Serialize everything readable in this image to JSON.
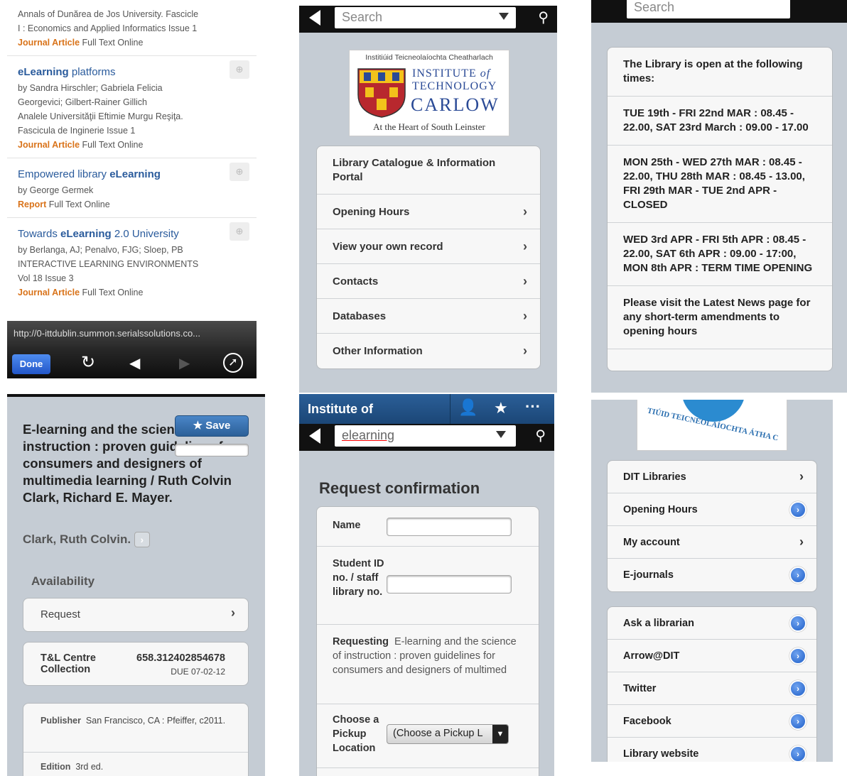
{
  "panelA": {
    "first": {
      "line1": "Annals of Dunărea de Jos University. Fascicle",
      "line2": "I : Economics and Applied Informatics Issue 1",
      "type": "Journal Article",
      "avail": "Full Text Online"
    },
    "results": [
      {
        "title_pre": "",
        "title_bold": "eLearning",
        "title_post": " platforms",
        "authors": [
          "by Sandra Hirschler; Gabriela Felicia",
          "Georgevici; Gilbert-Rainer Gillich",
          "Analele Universităţii Eftimie Murgu Reşiţa.",
          "Fascicula de Inginerie Issue 1"
        ],
        "type": "Journal Article",
        "avail": "Full Text Online"
      },
      {
        "title_pre": "Empowered library ",
        "title_bold": "eLearning",
        "title_post": "",
        "authors": [
          "by George Germek"
        ],
        "type": "Report",
        "avail": "Full Text Online"
      },
      {
        "title_pre": "Towards ",
        "title_bold": "eLearning",
        "title_post": " 2.0 University",
        "authors": [
          "by Berlanga, AJ; Penalvo, FJG; Sloep, PB",
          "INTERACTIVE LEARNING ENVIRONMENTS",
          "Vol 18 Issue 3"
        ],
        "type": "Journal Article",
        "avail": "Full Text Online"
      }
    ],
    "url": "http://0-ittdublin.summon.serialssolutions.co...",
    "done": "Done"
  },
  "panelB": {
    "search_placeholder": "Search",
    "logo": {
      "irish": "Institiúid Teicneolaíochta Cheatharlach",
      "inst": "INSTITUTE",
      "of": "of",
      "tech": "TECHNOLOGY",
      "carlow": "CARLOW",
      "tagline": "At the Heart of South Leinster"
    },
    "menu": [
      "Library Catalogue & Information Portal",
      "Opening Hours",
      "View your own record",
      "Contacts",
      "Databases",
      "Other Information"
    ]
  },
  "panelC": {
    "search_placeholder": "Search",
    "rows": [
      "The Library is open at the following times:",
      "TUE 19th - FRI 22nd MAR : 08.45 - 22.00, SAT 23rd March : 09.00 - 17.00",
      "MON 25th - WED 27th MAR : 08.45 - 22.00, THU 28th MAR : 08.45 - 13.00, FRI 29th MAR - TUE 2nd APR - CLOSED",
      "WED 3rd APR - FRI 5th APR : 08.45 - 22.00, SAT 6th APR : 09.00 - 17:00, MON 8th APR : TERM TIME OPENING",
      "Please visit the Latest News page for any short-term amendments to opening hours"
    ]
  },
  "panelD": {
    "title": "E-learning and the science of instruction : proven guidelines for consumers and designers of multimedia learning / Ruth Colvin Clark, Richard E. Mayer.",
    "save": "Save",
    "author": "Clark, Ruth Colvin.",
    "availability": "Availability",
    "request": "Request",
    "location": "T&L Centre Collection",
    "callno": "658.312402854678",
    "due": "DUE 07-02-12",
    "publisher_label": "Publisher",
    "publisher": "San Francisco, CA : Pfeiffer, c2011.",
    "edition_label": "Edition",
    "edition": "3rd ed."
  },
  "panelE": {
    "bar_title": "Institute of",
    "search_value": "elearning",
    "heading": "Request confirmation",
    "name_label": "Name",
    "id_label": "Student ID no. / staff library no.",
    "requesting_label": "Requesting",
    "requesting_value": "E-learning and the science of instruction : proven guidelines for consumers and designers of multimed",
    "pickup_label": "Choose a Pickup Location",
    "pickup_value": "(Choose a Pickup L"
  },
  "panelF": {
    "logo_text": "TIÚID TEICNEOLAÍOCHTA ÁTHA C",
    "group1": [
      {
        "label": "DIT Libraries",
        "icon": "chevron"
      },
      {
        "label": "Opening Hours",
        "icon": "blue"
      },
      {
        "label": "My account",
        "icon": "chevron"
      },
      {
        "label": "E-journals",
        "icon": "blue"
      }
    ],
    "group2": [
      {
        "label": "Ask a librarian",
        "icon": "blue"
      },
      {
        "label": "Arrow@DIT",
        "icon": "blue"
      },
      {
        "label": "Twitter",
        "icon": "blue"
      },
      {
        "label": "Facebook",
        "icon": "blue"
      },
      {
        "label": "Library website",
        "icon": "blue"
      }
    ]
  },
  "colors": {
    "ios_bg": "#c5ccd4",
    "link_blue": "#2a5b9c",
    "article_orange": "#d9731a",
    "bar_blue": "#1b4676"
  }
}
